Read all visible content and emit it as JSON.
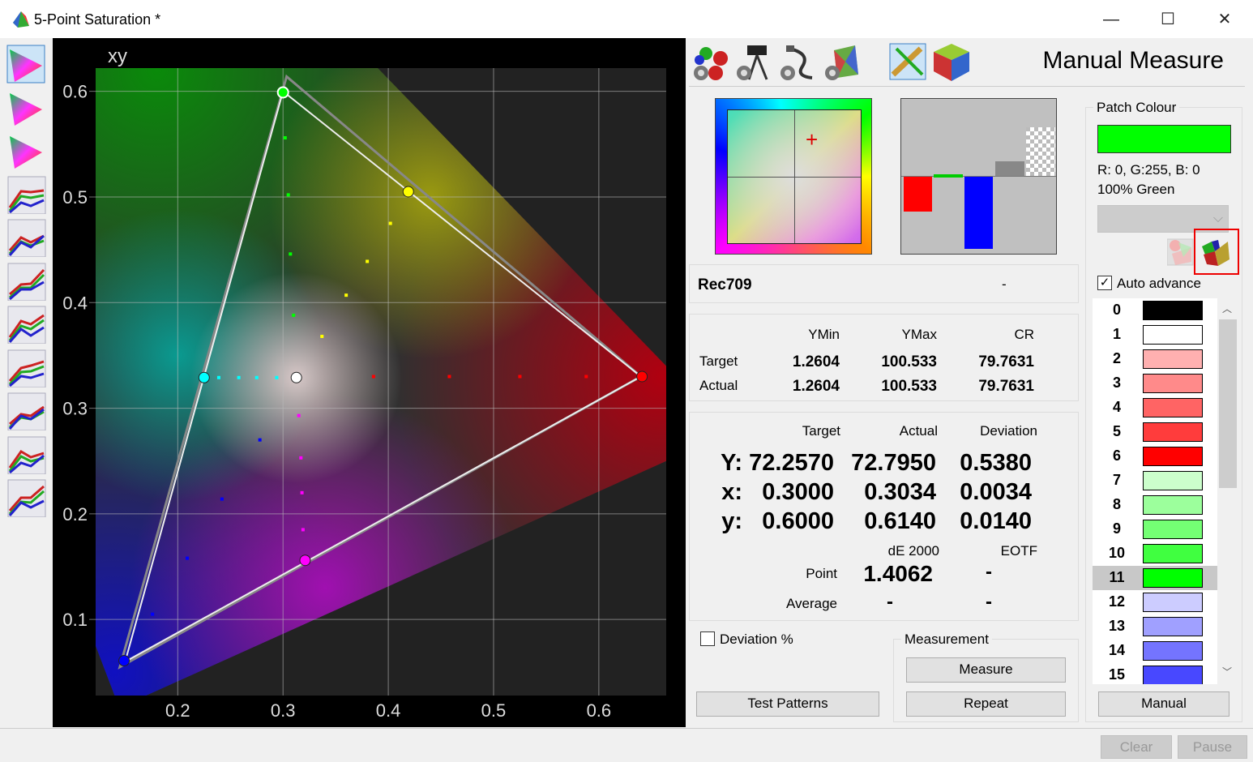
{
  "window": {
    "title": "5-Point Saturation *",
    "minimize": "—",
    "maximize": "☐",
    "close": "✕"
  },
  "left_toolbar": [
    "cie-diagram-icon",
    "gamut-icon",
    "3d-gamut-icon",
    "rgb-curves-icon",
    "rgb-balance-icon",
    "gamma-icon",
    "rgb-levels-icon",
    "luminance-icon",
    "eotf-icon",
    "deltae-icon",
    "rgb-deviation-icon"
  ],
  "top_toolbar": [
    "patterns-settings-icon",
    "meter-settings-icon",
    "connection-settings-icon",
    "display-settings-icon",
    "tools-icon",
    "cube-icon"
  ],
  "header": {
    "title": "Manual Measure"
  },
  "patch": {
    "group_label": "Patch Colour",
    "color": "#00ff00",
    "rgb_text": "R:  0, G:255, B:  0",
    "name": "100% Green",
    "auto_advance_label": "Auto advance",
    "auto_advance": true,
    "manual_label": "Manual"
  },
  "patches": [
    {
      "n": "0",
      "c": "#000000"
    },
    {
      "n": "1",
      "c": "#ffffff"
    },
    {
      "n": "2",
      "c": "#ffb0b0"
    },
    {
      "n": "3",
      "c": "#ff8a8a"
    },
    {
      "n": "4",
      "c": "#ff6464"
    },
    {
      "n": "5",
      "c": "#ff3c3c"
    },
    {
      "n": "6",
      "c": "#ff0000"
    },
    {
      "n": "7",
      "c": "#ccffcc"
    },
    {
      "n": "8",
      "c": "#9cff9c"
    },
    {
      "n": "9",
      "c": "#74ff74"
    },
    {
      "n": "10",
      "c": "#40ff40"
    },
    {
      "n": "11",
      "c": "#00ff00",
      "selected": true
    },
    {
      "n": "12",
      "c": "#ccccff"
    },
    {
      "n": "13",
      "c": "#a0a0ff"
    },
    {
      "n": "14",
      "c": "#7474ff"
    },
    {
      "n": "15",
      "c": "#4848ff"
    }
  ],
  "colorspace": {
    "name": "Rec709",
    "value": "-"
  },
  "contrast": {
    "headers": [
      "YMin",
      "YMax",
      "CR"
    ],
    "rows": [
      {
        "label": "Target",
        "values": [
          "1.2604",
          "100.533",
          "79.7631"
        ]
      },
      {
        "label": "Actual",
        "values": [
          "1.2604",
          "100.533",
          "79.7631"
        ]
      }
    ]
  },
  "measure": {
    "headers": [
      "Target",
      "Actual",
      "Deviation"
    ],
    "rows": [
      {
        "label": "Y:",
        "values": [
          "72.2570",
          "72.7950",
          "0.5380"
        ]
      },
      {
        "label": "x:",
        "values": [
          "0.3000",
          "0.3034",
          "0.0034"
        ]
      },
      {
        "label": "y:",
        "values": [
          "0.6000",
          "0.6140",
          "0.0140"
        ]
      }
    ],
    "de_label": "dE 2000",
    "eotf_label": "EOTF",
    "point_label": "Point",
    "point_de": "1.4062",
    "point_eotf": "-",
    "average_label": "Average",
    "average_de": "-",
    "average_eotf": "-"
  },
  "deviation_pct_label": "Deviation %",
  "measurement": {
    "group_label": "Measurement",
    "measure": "Measure",
    "repeat": "Repeat"
  },
  "test_patterns": "Test Patterns",
  "footer": {
    "clear": "Clear",
    "pause": "Pause"
  },
  "chart_data": {
    "type": "scatter",
    "title": "xy",
    "xlim": [
      0.122,
      0.664
    ],
    "ylim": [
      0.028,
      0.622
    ],
    "grid": true,
    "xticks": [
      "0.2",
      "0.3",
      "0.4",
      "0.5",
      "0.6"
    ],
    "yticks": [
      "0.1",
      "0.2",
      "0.3",
      "0.4",
      "0.5",
      "0.6"
    ],
    "target_gamut": [
      [
        0.3,
        0.6
      ],
      [
        0.64,
        0.33
      ],
      [
        0.15,
        0.06
      ]
    ],
    "actual_gamut": [
      [
        0.3034,
        0.614
      ],
      [
        0.64,
        0.33
      ],
      [
        0.145,
        0.055
      ]
    ],
    "white": [
      0.3127,
      0.329
    ],
    "series": [
      {
        "color": "#00ff00",
        "primary": [
          0.3,
          0.599
        ],
        "points": [
          [
            0.302,
            0.556
          ],
          [
            0.305,
            0.502
          ],
          [
            0.307,
            0.446
          ],
          [
            0.31,
            0.388
          ]
        ]
      },
      {
        "color": "#ffff00",
        "primary": [
          0.419,
          0.505
        ],
        "points": [
          [
            0.337,
            0.368
          ],
          [
            0.36,
            0.407
          ],
          [
            0.38,
            0.439
          ],
          [
            0.402,
            0.475
          ]
        ]
      },
      {
        "color": "#00ffff",
        "primary": [
          0.225,
          0.329
        ],
        "points": [
          [
            0.294,
            0.329
          ],
          [
            0.275,
            0.329
          ],
          [
            0.258,
            0.329
          ],
          [
            0.239,
            0.329
          ]
        ]
      },
      {
        "color": "#ff0000",
        "primary": [
          0.641,
          0.33
        ],
        "points": [
          [
            0.386,
            0.33
          ],
          [
            0.458,
            0.33
          ],
          [
            0.525,
            0.33
          ],
          [
            0.588,
            0.33
          ]
        ]
      },
      {
        "color": "#ff00ff",
        "primary": [
          0.321,
          0.156
        ],
        "points": [
          [
            0.315,
            0.293
          ],
          [
            0.317,
            0.253
          ],
          [
            0.318,
            0.22
          ],
          [
            0.319,
            0.185
          ]
        ]
      },
      {
        "color": "#0000ff",
        "primary": [
          0.149,
          0.061
        ],
        "points": [
          [
            0.278,
            0.27
          ],
          [
            0.242,
            0.214
          ],
          [
            0.209,
            0.158
          ],
          [
            0.176,
            0.105
          ]
        ]
      }
    ]
  }
}
